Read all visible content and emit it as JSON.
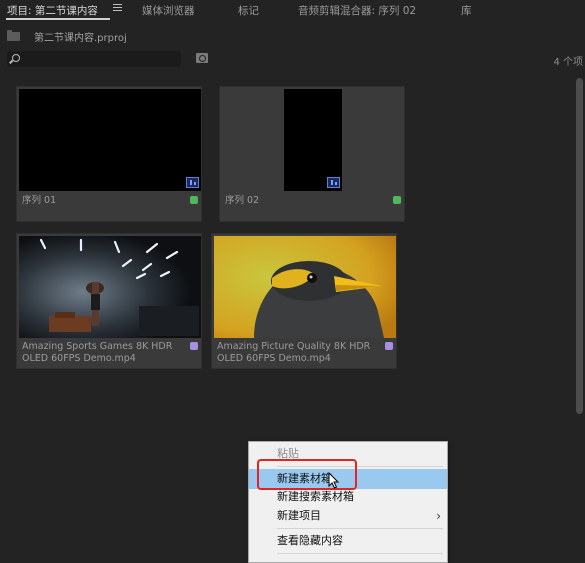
{
  "tabs": [
    {
      "label": "项目: 第二节课内容",
      "active": true
    },
    {
      "label": "媒体浏览器",
      "active": false
    },
    {
      "label": "标记",
      "active": false
    },
    {
      "label": "音频剪辑混合器: 序列 02",
      "active": false
    },
    {
      "label": "库",
      "active": false
    }
  ],
  "project": {
    "file_name": "第二节课内容.prproj"
  },
  "search": {
    "placeholder": "",
    "value": ""
  },
  "item_count": "4 个项",
  "items": [
    {
      "name": "序列 01",
      "type": "sequence",
      "label_color": "#4fb85c"
    },
    {
      "name": "序列 02",
      "type": "sequence",
      "label_color": "#4fb85c"
    },
    {
      "name_line1": "Amazing Sports Games 8K HDR",
      "name_line2": "OLED 60FPS Demo.mp4",
      "type": "video",
      "label_color": "#a88fe0"
    },
    {
      "name_line1": "Amazing Picture Quality 8K HDR",
      "name_line2": "OLED 60FPS Demo.mp4",
      "type": "video",
      "label_color": "#a88fe0"
    }
  ],
  "context_menu": {
    "items": [
      {
        "label": "粘贴",
        "enabled": false
      },
      {
        "label": "新建素材箱",
        "enabled": true,
        "hovered": true
      },
      {
        "label": "新建搜索素材箱",
        "enabled": true
      },
      {
        "label": "新建项目",
        "enabled": true,
        "submenu": true
      },
      {
        "label": "查看隐藏内容",
        "enabled": true
      }
    ],
    "submenu_arrow": "›"
  }
}
